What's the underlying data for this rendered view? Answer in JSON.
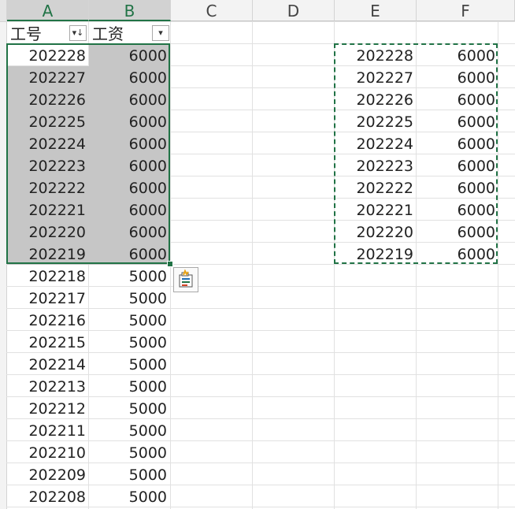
{
  "columns": [
    "A",
    "B",
    "C",
    "D",
    "E",
    "F"
  ],
  "header_row": {
    "a": "工号",
    "b": "工资"
  },
  "filter": {
    "a_icon": "sort-filter-icon",
    "b_icon": "dropdown-filter-icon",
    "a_glyph": "▾↓",
    "b_glyph": "▾"
  },
  "rows": [
    {
      "a": "202228",
      "b": "6000"
    },
    {
      "a": "202227",
      "b": "6000"
    },
    {
      "a": "202226",
      "b": "6000"
    },
    {
      "a": "202225",
      "b": "6000"
    },
    {
      "a": "202224",
      "b": "6000"
    },
    {
      "a": "202223",
      "b": "6000"
    },
    {
      "a": "202222",
      "b": "6000"
    },
    {
      "a": "202221",
      "b": "6000"
    },
    {
      "a": "202220",
      "b": "6000"
    },
    {
      "a": "202219",
      "b": "6000"
    },
    {
      "a": "202218",
      "b": "5000"
    },
    {
      "a": "202217",
      "b": "5000"
    },
    {
      "a": "202216",
      "b": "5000"
    },
    {
      "a": "202215",
      "b": "5000"
    },
    {
      "a": "202214",
      "b": "5000"
    },
    {
      "a": "202213",
      "b": "5000"
    },
    {
      "a": "202212",
      "b": "5000"
    },
    {
      "a": "202211",
      "b": "5000"
    },
    {
      "a": "202210",
      "b": "5000"
    },
    {
      "a": "202209",
      "b": "5000"
    },
    {
      "a": "202208",
      "b": "5000"
    }
  ],
  "pasted": [
    {
      "e": "202228",
      "f": "6000"
    },
    {
      "e": "202227",
      "f": "6000"
    },
    {
      "e": "202226",
      "f": "6000"
    },
    {
      "e": "202225",
      "f": "6000"
    },
    {
      "e": "202224",
      "f": "6000"
    },
    {
      "e": "202223",
      "f": "6000"
    },
    {
      "e": "202222",
      "f": "6000"
    },
    {
      "e": "202221",
      "f": "6000"
    },
    {
      "e": "202220",
      "f": "6000"
    },
    {
      "e": "202219",
      "f": "6000"
    }
  ],
  "colors": {
    "accent": "#217346",
    "selection_fill": "#c6c6c6",
    "gridline": "#e1e1e1"
  }
}
